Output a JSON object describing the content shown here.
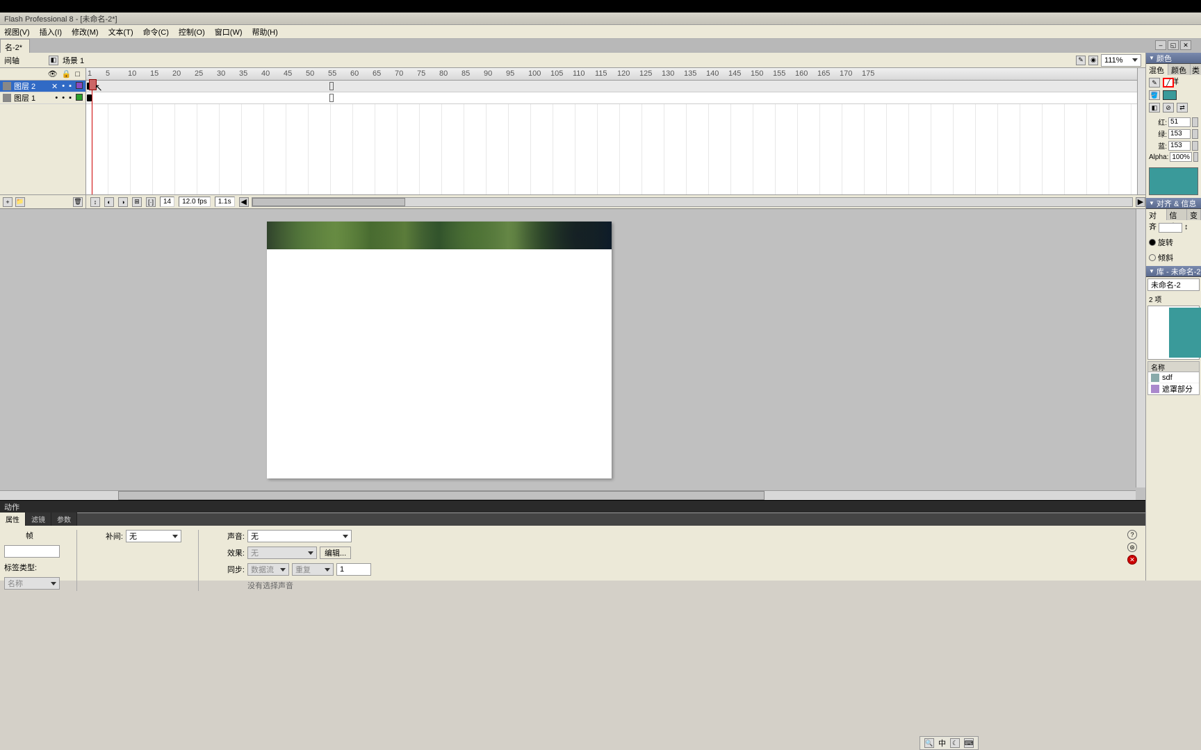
{
  "app_title": "Flash Professional 8 - [未命名-2*]",
  "menus": [
    "视图(V)",
    "插入(I)",
    "修改(M)",
    "文本(T)",
    "命令(C)",
    "控制(O)",
    "窗口(W)",
    "帮助(H)"
  ],
  "doc_tab": {
    "label": "名-2*"
  },
  "scene": {
    "timeline_label": "间轴",
    "name": "场景 1",
    "zoom": "111%"
  },
  "ruler_ticks": [
    "1",
    "5",
    "10",
    "15",
    "20",
    "25",
    "30",
    "35",
    "40",
    "45",
    "50",
    "55",
    "60",
    "65",
    "70",
    "75",
    "80",
    "85",
    "90",
    "95",
    "100",
    "105",
    "110",
    "115",
    "120",
    "125",
    "130",
    "135",
    "140",
    "145",
    "150",
    "155",
    "160",
    "165",
    "170",
    "175"
  ],
  "layers": [
    {
      "name": "图层 2",
      "selected": true,
      "color": "#8a4ac0"
    },
    {
      "name": "图层 1",
      "selected": false,
      "color": "#2aa02a"
    }
  ],
  "timeline_status": {
    "frame": "14",
    "fps": "12.0 fps",
    "time": "1.1s"
  },
  "actions_title": "动作",
  "props": {
    "tabs": [
      "属性",
      "滤镜",
      "参数"
    ],
    "frame_label": "帧",
    "label_type": "标签类型:",
    "label_type_value": "名称",
    "tween_label": "补间:",
    "tween_value": "无",
    "sound_label": "声音:",
    "sound_value": "无",
    "effect_label": "效果:",
    "effect_value": "无",
    "edit_btn": "编辑...",
    "sync_label": "同步:",
    "sync_v1": "数据流",
    "sync_v2": "重复",
    "sync_count": "1",
    "no_sound": "没有选择声音"
  },
  "color_panel": {
    "title": "颜色",
    "tabs": [
      "混色器",
      "颜色样"
    ],
    "type_label": "类",
    "red_label": "红:",
    "green_label": "绿:",
    "blue_label": "蓝:",
    "alpha_label": "Alpha:",
    "red": "51",
    "green": "153",
    "blue": "153",
    "alpha": "100%",
    "swatch_color": "#339999"
  },
  "align_panel": {
    "title": "对齐 & 信息",
    "tabs": [
      "对齐",
      "信息",
      "变"
    ],
    "rotate": "旋转",
    "skew": "倾斜"
  },
  "library": {
    "title": "库 - 未命名-2",
    "doc_name": "未命名-2",
    "count": "2 项",
    "col_name": "名称",
    "items": [
      {
        "name": "sdf",
        "type": "graphic"
      },
      {
        "name": "遮罩部分",
        "type": "mc"
      }
    ]
  },
  "ime": {
    "lang": "中"
  }
}
